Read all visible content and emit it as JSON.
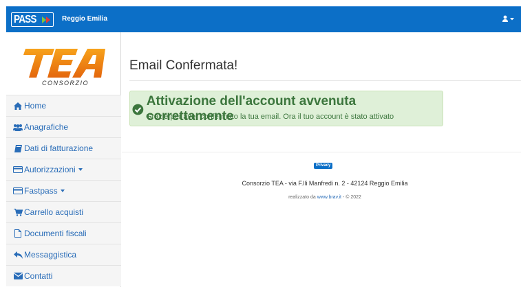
{
  "header": {
    "logo_text": "PASS",
    "city": "Reggio Emilia",
    "brand_color": "#0c6fc7",
    "user_icon": "user-icon"
  },
  "sidebar": {
    "logo_main": "TEA",
    "logo_sub": "CONSORZIO",
    "items": [
      {
        "label": "Home",
        "icon": "home-icon"
      },
      {
        "label": "Anagrafiche",
        "icon": "users-icon"
      },
      {
        "label": "Dati di fatturazione",
        "icon": "book-icon"
      },
      {
        "label": "Autorizzazioni",
        "icon": "card-icon",
        "dropdown": true
      },
      {
        "label": "Fastpass",
        "icon": "card-icon",
        "dropdown": true
      },
      {
        "label": "Carrello acquisti",
        "icon": "cart-icon"
      },
      {
        "label": "Documenti fiscali",
        "icon": "file-icon"
      },
      {
        "label": "Messaggistica",
        "icon": "reply-icon"
      },
      {
        "label": "Contatti",
        "icon": "envelope-icon"
      }
    ]
  },
  "main": {
    "title": "Email Confermata!",
    "alert": {
      "title": "Attivazione dell'account avvenuta correttamente",
      "text": "Grazie per aver confermato la tua email. Ora il tuo account è stato attivato",
      "color": "#3c763d",
      "background": "#dff0d8"
    }
  },
  "footer": {
    "privacy_label": "Privacy",
    "address": "Consorzio TEA - via F.lli Manfredi n. 2 - 42124 Reggio Emilia",
    "credits_prefix": "realizzato da",
    "credits_link": "www.brav.it",
    "credits_suffix": "- © 2022"
  }
}
